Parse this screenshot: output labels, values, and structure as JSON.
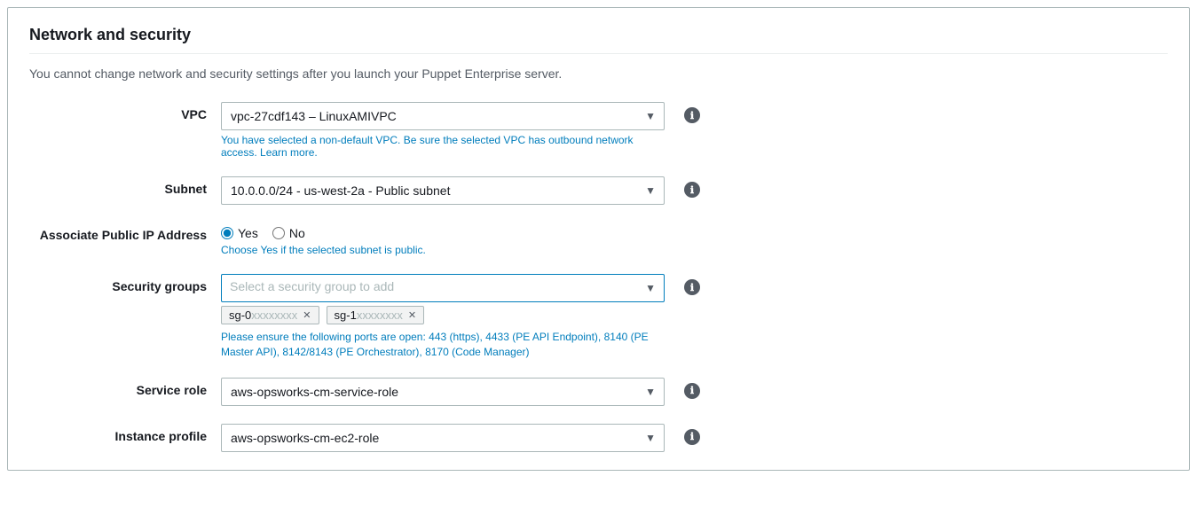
{
  "page": {
    "title": "Network and security",
    "subtitle": "You cannot change network and security settings after you launch your Puppet Enterprise server."
  },
  "vpc": {
    "label": "VPC",
    "value": "vpc-27cdf143 – LinuxAMIVPC",
    "hint": "You have selected a non-default VPC. Be sure the selected VPC has outbound network access.",
    "hint_link_text": "Learn more.",
    "info_icon": "ℹ"
  },
  "subnet": {
    "label": "Subnet",
    "value": "10.0.0.0/24 - us-west-2a - Public subnet",
    "info_icon": "ℹ"
  },
  "associate_public_ip": {
    "label": "Associate Public IP Address",
    "options": [
      "Yes",
      "No"
    ],
    "selected": "Yes",
    "hint": "Choose Yes if the selected subnet is public."
  },
  "security_groups": {
    "label": "Security groups",
    "placeholder": "Select a security group to add",
    "info_icon": "ℹ",
    "selected_groups": [
      {
        "id": "sg-0",
        "suffix": "xxxxxxxx"
      },
      {
        "id": "sg-1",
        "suffix": "xxxxxxxx"
      }
    ],
    "ports_hint": "Please ensure the following ports are open: 443 (https), 4433 (PE API Endpoint), 8140 (PE Master API), 8142/8143 (PE Orchestrator), 8170 (Code Manager)"
  },
  "service_role": {
    "label": "Service role",
    "value": "aws-opsworks-cm-service-role",
    "info_icon": "ℹ"
  },
  "instance_profile": {
    "label": "Instance profile",
    "value": "aws-opsworks-cm-ec2-role",
    "info_icon": "ℹ"
  },
  "icons": {
    "dropdown_arrow": "▼",
    "close": "✕"
  }
}
